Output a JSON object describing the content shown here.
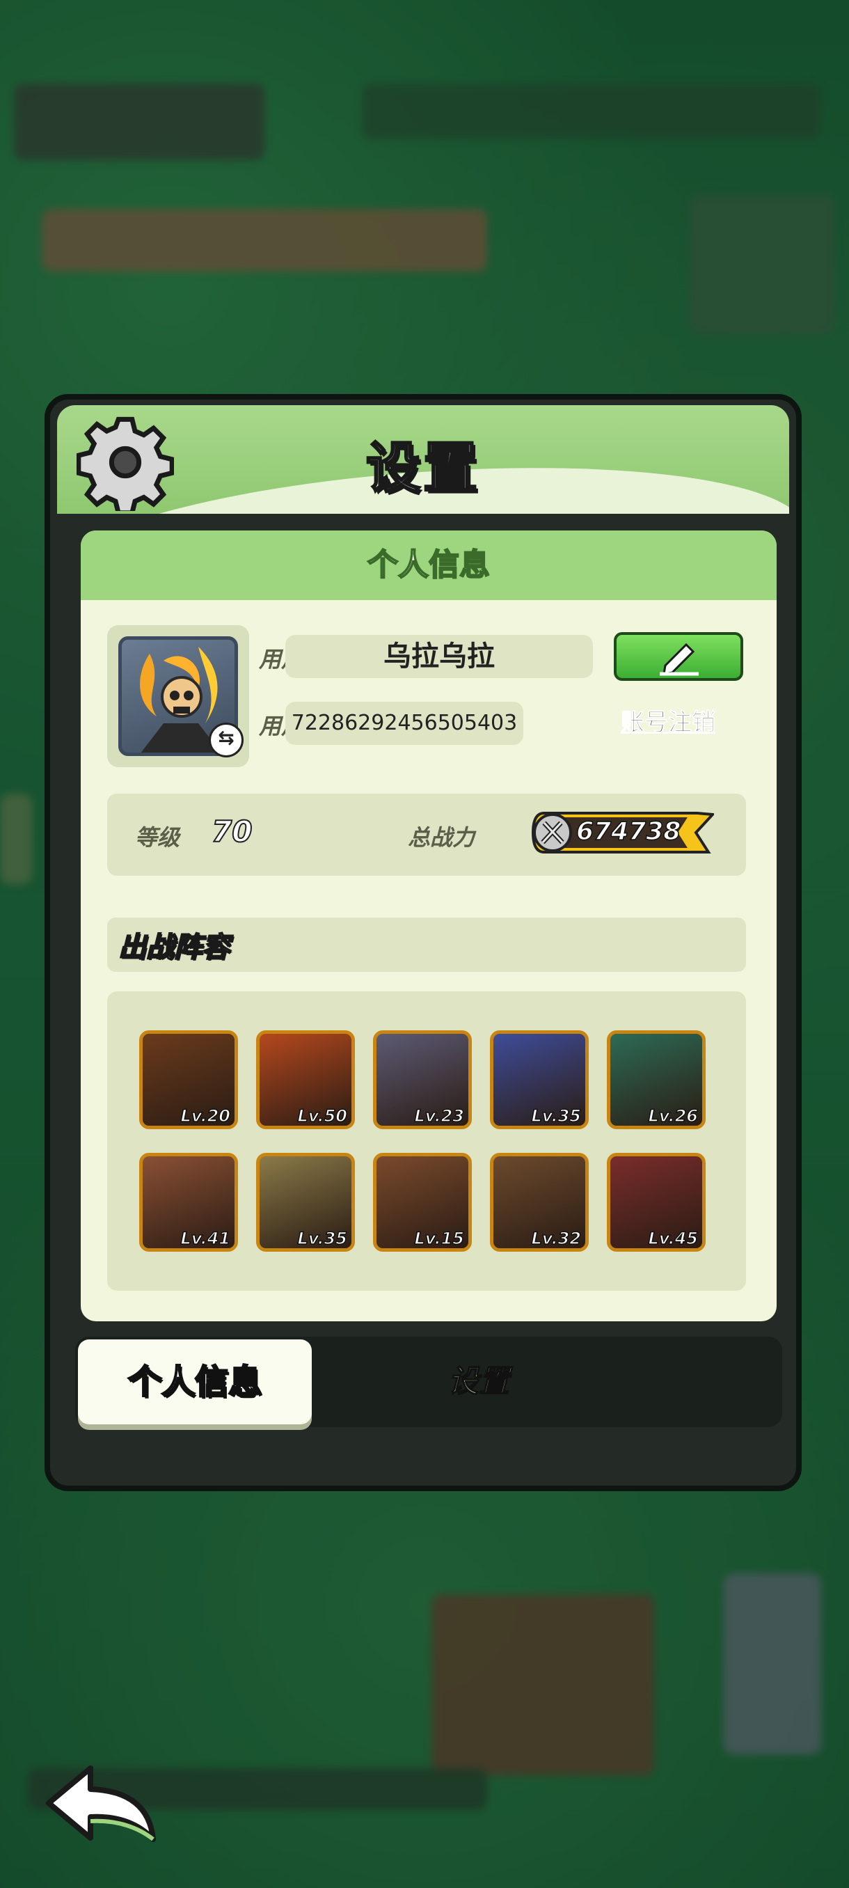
{
  "panel": {
    "title": "设置",
    "section_header": "个人信息"
  },
  "profile": {
    "nickname_label": "用户昵称",
    "nickname_value": "乌拉乌拉",
    "id_label": "用户 ID",
    "id_value": "72286292456505403",
    "cancel_account_link": "账号注销",
    "swap_icon": "swap-icon",
    "edit_icon": "pencil-icon"
  },
  "stats": {
    "level_label": "等级",
    "level_value": "70",
    "power_label": "总战力",
    "power_value": "674738"
  },
  "lineup": {
    "title": "出战阵容",
    "heroes": [
      {
        "level": "Lv.20",
        "color": "#6b3b1c"
      },
      {
        "level": "Lv.50",
        "color": "#b5481e"
      },
      {
        "level": "Lv.23",
        "color": "#5d5a74"
      },
      {
        "level": "Lv.35",
        "color": "#3f4d9a"
      },
      {
        "level": "Lv.26",
        "color": "#2d6b55"
      },
      {
        "level": "Lv.41",
        "color": "#8a5034"
      },
      {
        "level": "Lv.35",
        "color": "#8b7a48"
      },
      {
        "level": "Lv.15",
        "color": "#7a4a2c"
      },
      {
        "level": "Lv.32",
        "color": "#6c4a2d"
      },
      {
        "level": "Lv.45",
        "color": "#7a2d2b"
      }
    ]
  },
  "tabs": {
    "active": "个人信息",
    "settings": "设置"
  },
  "colors": {
    "header_green": "#9dd67f",
    "card_bg": "#f1f6dc",
    "panel_dark": "#242b26",
    "hero_border": "#c98512",
    "button_green": "#3cae33"
  }
}
